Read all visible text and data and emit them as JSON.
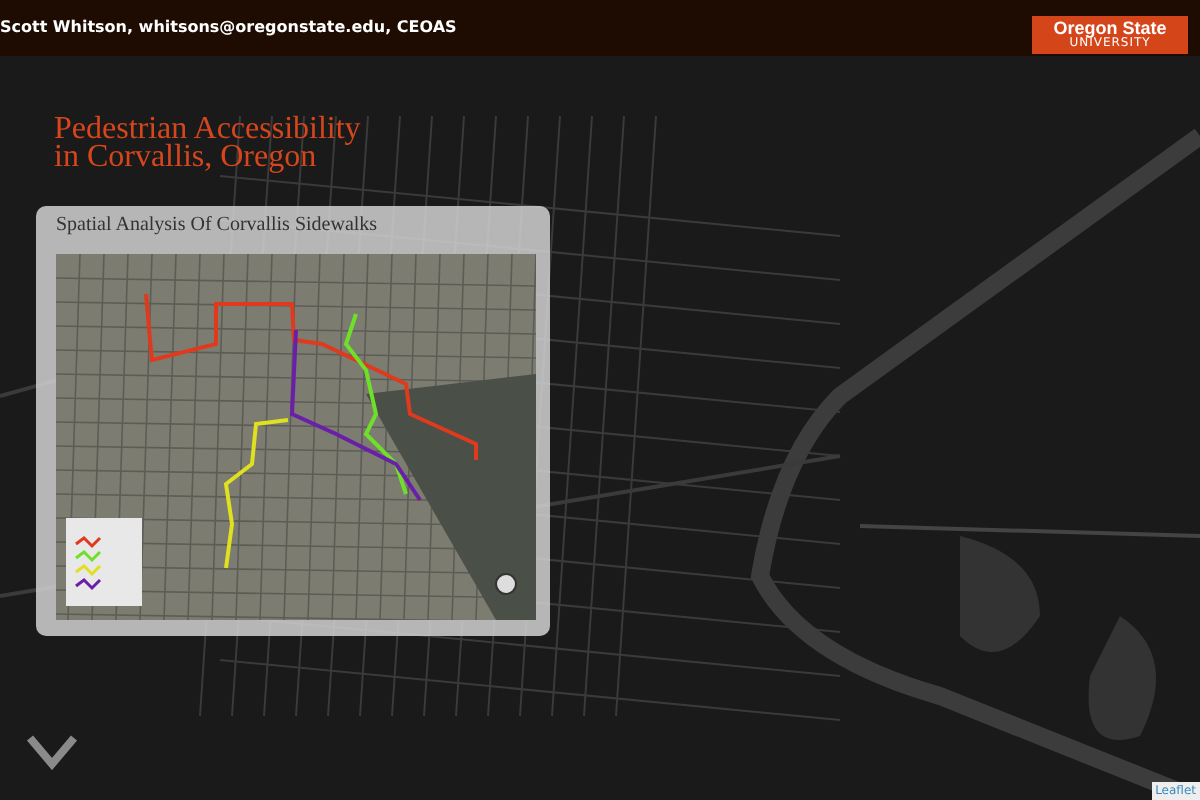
{
  "header": {
    "author_line": "Scott Whitson, whitsons@oregonstate.edu, CEOAS",
    "logo": {
      "name": "Oregon State",
      "subtitle": "UNIVERSITY"
    }
  },
  "title_lines": [
    "Pedestrian Accessibility",
    "in Corvallis, Oregon"
  ],
  "card": {
    "title": "Spatial Analysis Of Corvallis Sidewalks"
  },
  "attribution": "Leaflet"
}
